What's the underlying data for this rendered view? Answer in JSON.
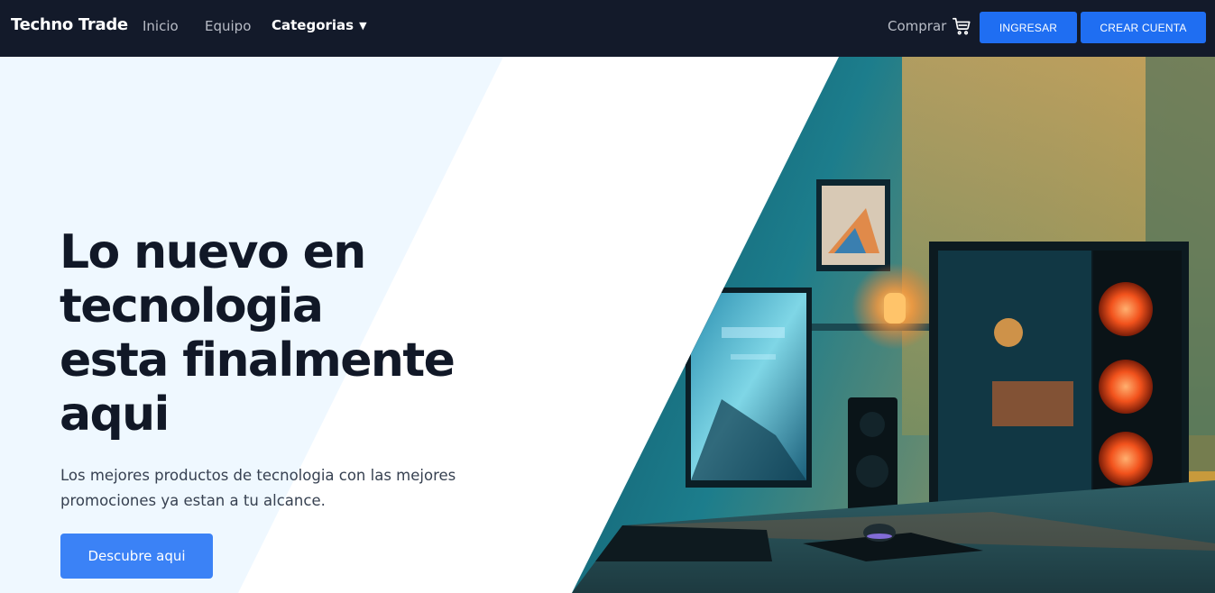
{
  "navbar": {
    "brand": "Techno Trade",
    "links": {
      "inicio": "Inicio",
      "equipo": "Equipo",
      "categorias": "Categorias"
    },
    "caret_glyph": "▼",
    "buy_label": "Comprar",
    "cart_icon": "cart-icon",
    "login_label": "INGRESAR",
    "signup_label": "CREAR CUENTA"
  },
  "hero": {
    "title_lines": [
      "Lo nuevo en",
      "tecnologia",
      "esta finalmente",
      "aqui"
    ],
    "description": "Los mejores productos de tecnologia con las mejores promociones ya estan a tu alcance.",
    "cta_label": "Descubre aqui",
    "image_subject": "gaming-pc-setup-photo"
  },
  "colors": {
    "navbar_bg": "#131a2a",
    "accent_button": "#1f6ef2",
    "cta_button": "#3b82f6",
    "hero_light_bg": "#eff8ff",
    "heading_text": "#111827"
  }
}
